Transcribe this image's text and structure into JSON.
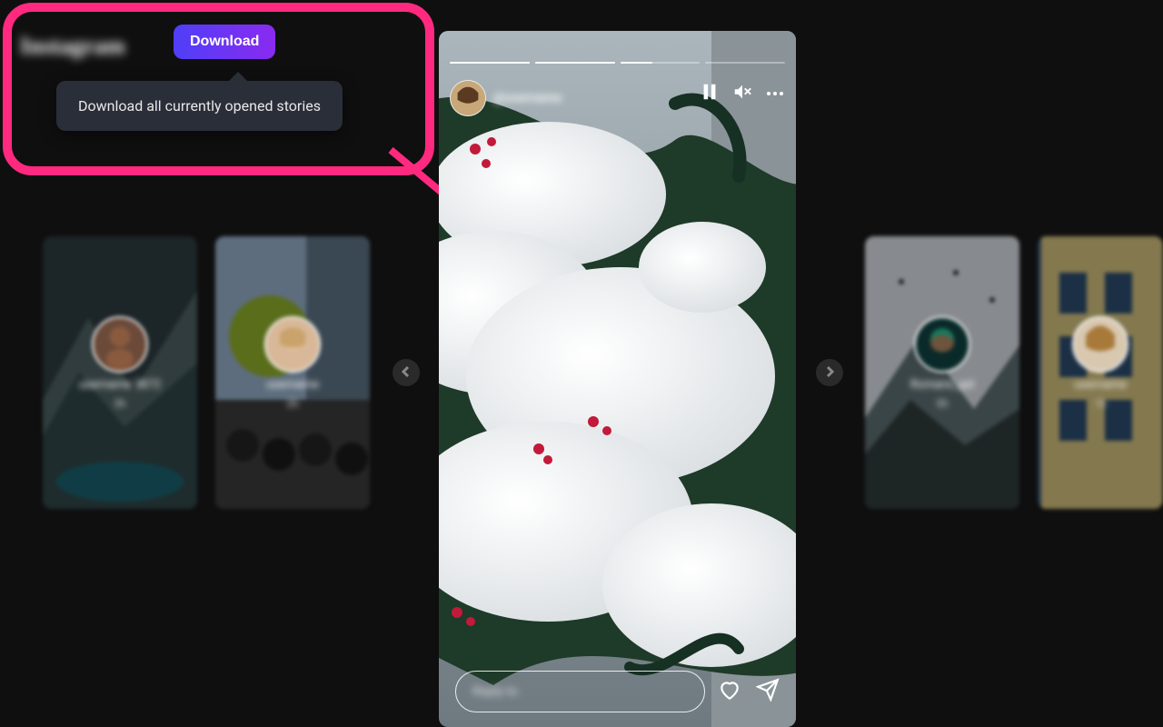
{
  "header": {
    "logo_text": "Instagram",
    "download_label": "Download",
    "tooltip_text": "Download all currently opened stories"
  },
  "annotation": {
    "highlight_color": "#ff2a7f"
  },
  "main_story": {
    "username": "@username",
    "segments_total": 4,
    "segments_complete": 2,
    "current_segment_progress": 0.4,
    "reply_placeholder": "Reply to",
    "controls": {
      "pause_icon": "pause-icon",
      "mute_icon": "volume-muted-icon",
      "more_icon": "more-icon"
    },
    "actions": {
      "like_icon": "heart-icon",
      "share_icon": "send-icon"
    }
  },
  "previews": [
    {
      "username": "username 3872",
      "time": "3h"
    },
    {
      "username": "username",
      "time": "2h"
    },
    {
      "username": "Romans_jail",
      "time": "5h"
    },
    {
      "username": "username",
      "time": "1h"
    }
  ],
  "colors": {
    "accent_gradient_from": "#4f3ff7",
    "accent_gradient_to": "#8a2af0",
    "tooltip_bg": "#2a2e39"
  }
}
